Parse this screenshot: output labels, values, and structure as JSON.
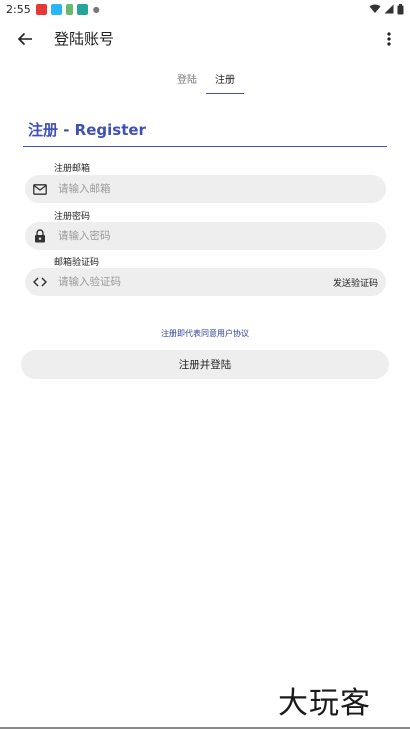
{
  "status_bar": {
    "time": "2:55",
    "notification_icons": [
      "app-notification-red",
      "app-notification-blue",
      "app-notification-green",
      "app-notification-teal"
    ],
    "right_icons": [
      "wifi-icon",
      "signal-icon",
      "battery-icon"
    ]
  },
  "app_bar": {
    "back_icon": "arrow-back-icon",
    "title": "登陆账号",
    "menu_icon": "more-vert-icon"
  },
  "tabs": [
    {
      "label": "登陆",
      "active": false
    },
    {
      "label": "注册",
      "active": true
    }
  ],
  "register": {
    "title": "注册 - Register",
    "email": {
      "label": "注册邮箱",
      "placeholder": "请输入邮箱",
      "value": "",
      "icon": "mail-icon"
    },
    "password": {
      "label": "注册密码",
      "placeholder": "请输入密码",
      "value": "",
      "icon": "lock-icon"
    },
    "code": {
      "label": "邮箱验证码",
      "placeholder": "请输入验证码",
      "value": "",
      "icon": "code-icon",
      "send_label": "发送验证码"
    },
    "agreement": "注册即代表同意用户协议",
    "submit_label": "注册并登陆"
  },
  "watermark": "大玩客",
  "colors": {
    "accent": "#3f51b5",
    "field_bg": "#eeeeee",
    "link": "#2b3ea0"
  }
}
